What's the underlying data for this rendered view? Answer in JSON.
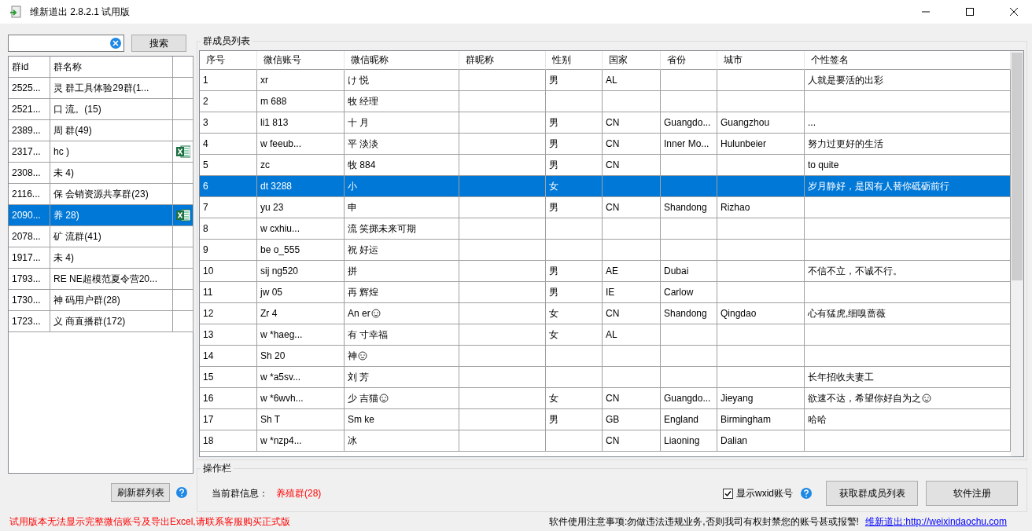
{
  "window": {
    "title": "维新道出 2.8.2.1 试用版"
  },
  "search": {
    "button": "搜索"
  },
  "group_table": {
    "columns": [
      "群id",
      "群名称"
    ],
    "rows": [
      {
        "id": "2525...",
        "name": "灵 群工具体验29群(1...",
        "excel": false,
        "selected": false
      },
      {
        "id": "2521...",
        "name": "口 流。(15)",
        "excel": false,
        "selected": false
      },
      {
        "id": "2389...",
        "name": "周 群(49)",
        "excel": false,
        "selected": false
      },
      {
        "id": "2317...",
        "name": "hc )",
        "excel": true,
        "selected": false
      },
      {
        "id": "2308...",
        "name": "未 4)",
        "excel": false,
        "selected": false
      },
      {
        "id": "2116...",
        "name": "保 会销资源共享群(23)",
        "excel": false,
        "selected": false
      },
      {
        "id": "2090...",
        "name": "养 28)",
        "excel": true,
        "selected": true
      },
      {
        "id": "2078...",
        "name": "矿 流群(41)",
        "excel": false,
        "selected": false
      },
      {
        "id": "1917...",
        "name": "未 4)",
        "excel": false,
        "selected": false
      },
      {
        "id": "1793...",
        "name": "RE NE超模范夏令营20...",
        "excel": false,
        "selected": false
      },
      {
        "id": "1730...",
        "name": "神 码用户群(28)",
        "excel": false,
        "selected": false
      },
      {
        "id": "1723...",
        "name": "义 商直播群(172)",
        "excel": false,
        "selected": false
      }
    ]
  },
  "refresh_button": "刷新群列表",
  "members": {
    "legend": "群成员列表",
    "columns": [
      "序号",
      "微信账号",
      "微信昵称",
      "群昵称",
      "性别",
      "国家",
      "省份",
      "城市",
      "个性签名"
    ],
    "rows": [
      {
        "cells": [
          "1",
          "xr",
          "け 悦",
          "",
          "男",
          "AL",
          "",
          "",
          "人就是要活的出彩"
        ],
        "selected": false
      },
      {
        "cells": [
          "2",
          "m 688",
          "牧 经理",
          "",
          "",
          "",
          "",
          "",
          ""
        ],
        "selected": false
      },
      {
        "cells": [
          "3",
          "li1 813",
          "十 月",
          "",
          "男",
          "CN",
          "Guangdo...",
          "Guangzhou",
          "..."
        ],
        "selected": false
      },
      {
        "cells": [
          "4",
          "w feeub...",
          "平 淡淡",
          "",
          "男",
          "CN",
          "Inner Mo...",
          "Hulunbeier",
          "努力过更好的生活"
        ],
        "selected": false
      },
      {
        "cells": [
          "5",
          "zc",
          "牧 884",
          "",
          "男",
          "CN",
          "",
          "",
          "to quite"
        ],
        "selected": false
      },
      {
        "cells": [
          "6",
          "dt 3288",
          "小",
          "",
          "女",
          "",
          "",
          "",
          "岁月静好，是因有人替你砥砺前行"
        ],
        "selected": true
      },
      {
        "cells": [
          "7",
          "yu 23",
          "申",
          "",
          "男",
          "CN",
          "Shandong",
          "Rizhao",
          ""
        ],
        "selected": false
      },
      {
        "cells": [
          "8",
          "w cxhiu...",
          "流 笑掷未来可期",
          "",
          "",
          "",
          "",
          "",
          ""
        ],
        "selected": false
      },
      {
        "cells": [
          "9",
          "be o_555",
          "祝 好运",
          "",
          "",
          "",
          "",
          "",
          ""
        ],
        "selected": false
      },
      {
        "cells": [
          "10",
          "sij ng520",
          "拼",
          "",
          "男",
          "AE",
          "Dubai",
          "",
          "不信不立，不诚不行。"
        ],
        "selected": false
      },
      {
        "cells": [
          "11",
          "jw 05",
          "再 辉煌",
          "",
          "男",
          "IE",
          "Carlow",
          "",
          ""
        ],
        "selected": false
      },
      {
        "cells": [
          "12",
          "Zr 4",
          "An er",
          "",
          "女",
          "CN",
          "Shandong",
          "Qingdao",
          "心有猛虎,细嗅蔷薇"
        ],
        "selected": false,
        "nick_emoji": true
      },
      {
        "cells": [
          "13",
          "w *haeg...",
          "有 寸幸福",
          "",
          "女",
          "AL",
          "",
          "",
          ""
        ],
        "selected": false
      },
      {
        "cells": [
          "14",
          "Sh 20",
          "神",
          "",
          "",
          "",
          "",
          "",
          ""
        ],
        "selected": false,
        "nick_emoji": true
      },
      {
        "cells": [
          "15",
          "w *a5sv...",
          "刘 芳",
          "",
          "",
          "",
          "",
          "",
          "长年招收夫妻工"
        ],
        "selected": false
      },
      {
        "cells": [
          "16",
          "w *6wvh...",
          "少 吉猫",
          "",
          "女",
          "CN",
          "Guangdo...",
          "Jieyang",
          "欲速不达，希望你好自为之"
        ],
        "selected": false,
        "nick_emoji": true,
        "sign_emoji": true
      },
      {
        "cells": [
          "17",
          "Sh T",
          "Sm ke",
          "",
          "男",
          "GB",
          "England",
          "Birmingham",
          "哈哈"
        ],
        "selected": false
      },
      {
        "cells": [
          "18",
          "w *nzp4...",
          "冰",
          "",
          "",
          "CN",
          "Liaoning",
          "Dalian",
          ""
        ],
        "selected": false
      }
    ]
  },
  "actions": {
    "legend": "操作栏",
    "info_label": "当前群信息：",
    "info_value": "养殖群(28)",
    "show_wxid": {
      "label": "显示wxid账号",
      "checked": true
    },
    "buttons": [
      "获取群成员列表",
      "软件注册"
    ]
  },
  "footer": {
    "warning": "试用版本无法显示完整微信账号及导出Excel,请联系客服购买正式版",
    "notice": "软件使用注意事项:勿做违法违规业务,否则我司有权封禁您的账号甚或报警!",
    "link_label": "维新道出:",
    "link_url": "http://weixindaochu.com"
  }
}
